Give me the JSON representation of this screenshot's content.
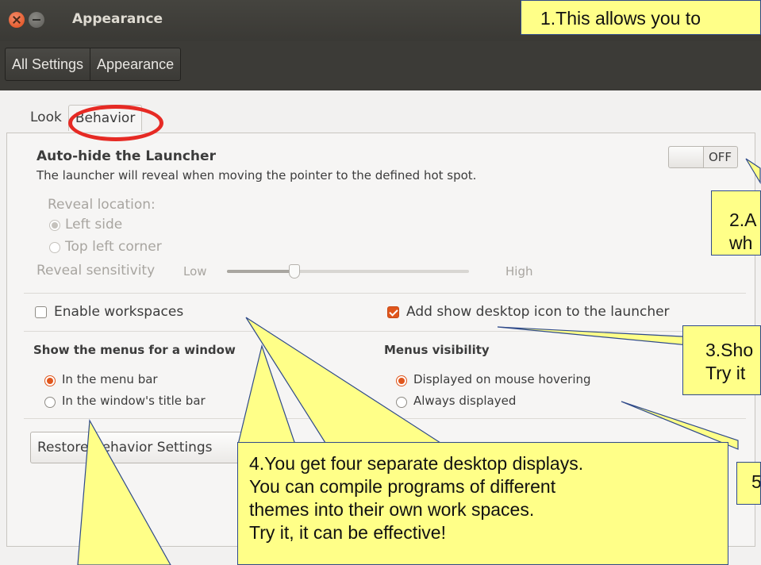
{
  "window": {
    "title": "Appearance",
    "close_icon": "close-icon",
    "minimize_icon": "minimize-icon"
  },
  "breadcrumb": [
    "All Settings",
    "Appearance"
  ],
  "tabs": [
    "Look",
    "Behavior"
  ],
  "autohide": {
    "title": "Auto-hide the Launcher",
    "description": "The launcher will reveal when moving the pointer to the defined hot spot.",
    "toggle": "OFF",
    "reveal_location_label": "Reveal location:",
    "reveal_options": [
      "Left side",
      "Top left corner"
    ],
    "reveal_selected": "Left side",
    "sensitivity_label": "Reveal sensitivity",
    "sensitivity_low": "Low",
    "sensitivity_high": "High",
    "sensitivity_value": 0.28
  },
  "workspaces": {
    "label": "Enable workspaces",
    "checked": false
  },
  "show_desktop": {
    "label": "Add show desktop icon to the launcher",
    "checked": true
  },
  "menus_window": {
    "title": "Show the menus for a window",
    "options": [
      "In the menu bar",
      "In the window's title bar"
    ],
    "selected": "In the menu bar"
  },
  "menus_visibility": {
    "title": "Menus visibility",
    "options": [
      "Displayed on mouse hovering",
      "Always displayed"
    ],
    "selected": "Displayed on mouse hovering"
  },
  "restore_button": "Restore Behavior Settings",
  "annotations": {
    "c1": "1.This allows you to",
    "c2": [
      "2.A",
      "wh"
    ],
    "c3": [
      "3.Sho",
      "Try it"
    ],
    "c4": [
      "4.You get four separate desktop displays.",
      "You can compile programs of different",
      "themes into their own work spaces.",
      "Try it, it can be effective!"
    ],
    "c5": "5",
    "color": "#ffff88"
  }
}
